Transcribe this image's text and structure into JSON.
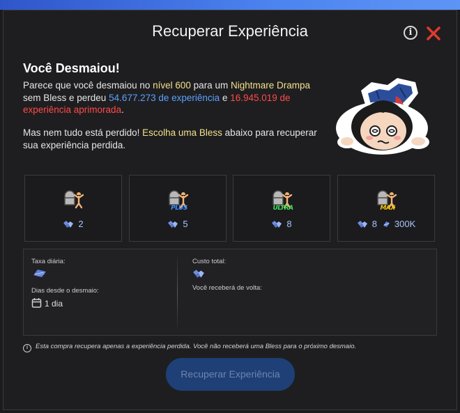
{
  "dialog": {
    "title": "Recuperar Experiência",
    "info_icon": "info-icon",
    "info_glyph": "i",
    "close_icon": "close-icon"
  },
  "message": {
    "heading": "Você Desmaiou!",
    "p1_a": "Parece que você desmaiou no ",
    "p1_level": "nível 600",
    "p1_b": " para um ",
    "p1_monster": "Nightmare Drampa",
    "p1_c": " sem Bless e perdeu ",
    "p1_exp": "54.677.273 de experiência",
    "p1_d": " e ",
    "p1_refined": "16.945.019 de experiência aprimorada",
    "p1_e": ".",
    "p2_a": "Mas nem tudo está perdido! ",
    "p2_highlight": "Escolha uma Bless",
    "p2_b": " abaixo para recuperar sua experiência perdida."
  },
  "bless_options": [
    {
      "tier_label": "",
      "gems": "2",
      "coins": ""
    },
    {
      "tier_label": "PLUS",
      "gems": "5",
      "coins": ""
    },
    {
      "tier_label": "ULTRA",
      "gems": "8",
      "coins": ""
    },
    {
      "tier_label": "MAX",
      "gems": "8",
      "coins": "300K"
    }
  ],
  "summary": {
    "daily_fee_label": "Taxa diária:",
    "days_label": "Dias desde o desmaio:",
    "days_value": "1 dia",
    "total_cost_label": "Custo total:",
    "refund_label": "Você receberá de volta:"
  },
  "footer": {
    "note_glyph": "i",
    "note": "Esta compra recupera apenas a experiência perdida. Você não receberá uma Bless para o próximo desmaio.",
    "button_label": "Recuperar Experiência"
  },
  "colors": {
    "accent_yellow": "#f2e08a",
    "accent_blue": "#5ba1ff",
    "accent_red": "#ff4a4a",
    "button_bg": "#1f3f77",
    "close_red": "#e03a2f"
  }
}
